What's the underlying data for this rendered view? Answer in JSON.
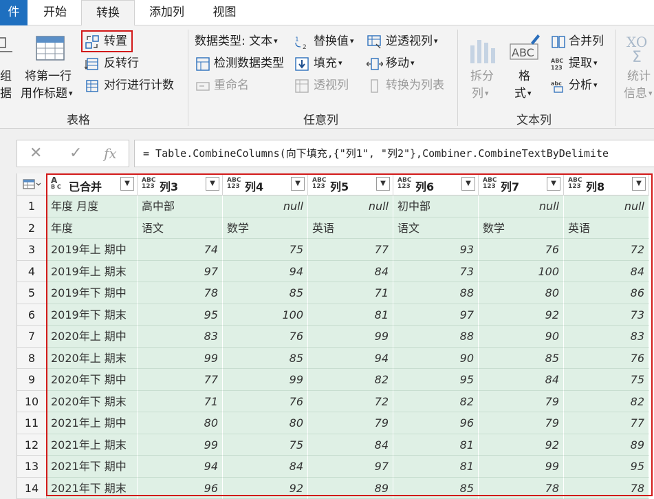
{
  "tabs": {
    "file": "件",
    "home": "开始",
    "transform": "转换",
    "add_column": "添加列",
    "view": "视图"
  },
  "ribbon": {
    "table_group": {
      "label": "表格",
      "group_by_top": "组",
      "group_by_bottom": "据",
      "use_first_row_line1": "将第一行",
      "use_first_row_line2": "用作标题",
      "transpose": "转置",
      "reverse_rows": "反转行",
      "count_rows": "对行进行计数"
    },
    "any_column_group": {
      "label": "任意列",
      "data_type": "数据类型: 文本",
      "detect_type": "检测数据类型",
      "rename": "重命名",
      "replace_values": "替换值",
      "fill": "填充",
      "pivot": "透视列",
      "unpivot": "逆透视列",
      "move": "移动",
      "convert_to_list": "转换为列表"
    },
    "text_column_group": {
      "label": "文本列",
      "split_line1": "拆分",
      "split_line2": "列",
      "format_line1": "格",
      "format_line2": "式",
      "merge_columns": "合并列",
      "extract": "提取",
      "parse": "分析"
    },
    "number_group": {
      "stats_line1": "统计",
      "stats_line2": "信息"
    }
  },
  "formula_bar": {
    "cancel": "✕",
    "confirm": "✓",
    "fx": "fx",
    "formula": "= Table.CombineColumns(向下填充,{\"列1\", \"列2\"},Combiner.CombineTextByDelimite"
  },
  "grid": {
    "columns": [
      {
        "name": "已合并",
        "type_top": "A",
        "type_bottom": "B C"
      },
      {
        "name": "列3",
        "type_top": "ABC",
        "type_bottom": "123"
      },
      {
        "name": "列4",
        "type_top": "ABC",
        "type_bottom": "123"
      },
      {
        "name": "列5",
        "type_top": "ABC",
        "type_bottom": "123"
      },
      {
        "name": "列6",
        "type_top": "ABC",
        "type_bottom": "123"
      },
      {
        "name": "列7",
        "type_top": "ABC",
        "type_bottom": "123"
      },
      {
        "name": "列8",
        "type_top": "ABC",
        "type_bottom": "123"
      }
    ],
    "rows": [
      [
        "1",
        "年度 月度",
        "高中部",
        "null",
        "null",
        "初中部",
        "null",
        "null"
      ],
      [
        "2",
        "年度",
        "语文",
        "数学",
        "英语",
        "语文",
        "数学",
        "英语"
      ],
      [
        "3",
        "2019年上 期中",
        "74",
        "75",
        "77",
        "93",
        "76",
        "72"
      ],
      [
        "4",
        "2019年上 期末",
        "97",
        "94",
        "84",
        "73",
        "100",
        "84"
      ],
      [
        "5",
        "2019年下 期中",
        "78",
        "85",
        "71",
        "88",
        "80",
        "86"
      ],
      [
        "6",
        "2019年下 期末",
        "95",
        "100",
        "81",
        "97",
        "92",
        "73"
      ],
      [
        "7",
        "2020年上 期中",
        "83",
        "76",
        "99",
        "88",
        "90",
        "83"
      ],
      [
        "8",
        "2020年上 期末",
        "99",
        "85",
        "94",
        "90",
        "85",
        "76"
      ],
      [
        "9",
        "2020年下 期中",
        "77",
        "99",
        "82",
        "95",
        "84",
        "75"
      ],
      [
        "10",
        "2020年下 期末",
        "71",
        "76",
        "72",
        "82",
        "79",
        "82"
      ],
      [
        "11",
        "2021年上 期中",
        "80",
        "80",
        "79",
        "96",
        "79",
        "77"
      ],
      [
        "12",
        "2021年上 期末",
        "99",
        "75",
        "84",
        "81",
        "92",
        "89"
      ],
      [
        "13",
        "2021年下 期中",
        "94",
        "84",
        "97",
        "81",
        "99",
        "95"
      ],
      [
        "14",
        "2021年下 期末",
        "96",
        "92",
        "89",
        "85",
        "78",
        "78"
      ]
    ]
  }
}
